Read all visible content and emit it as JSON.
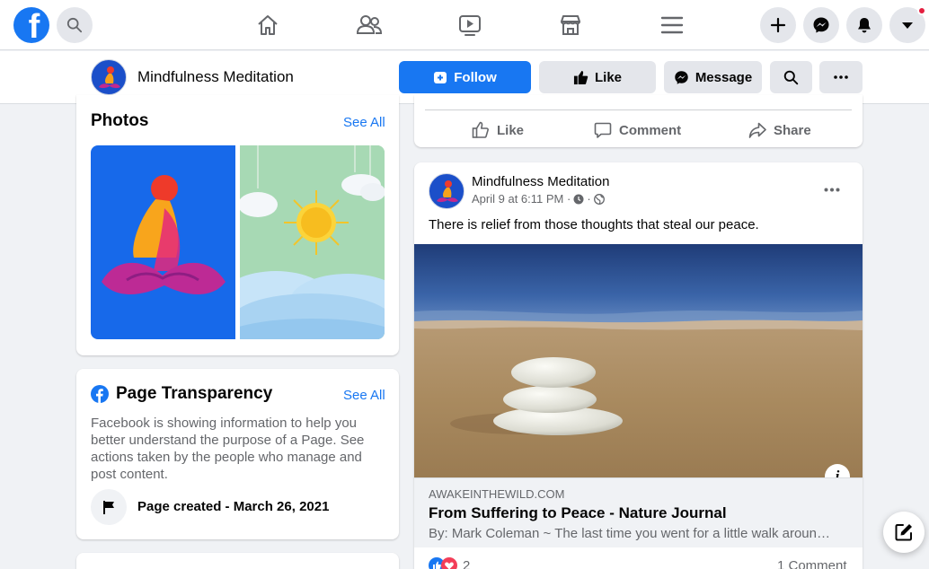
{
  "nav": {
    "logo_letter": "f",
    "icons": [
      "search-icon",
      "home-icon",
      "friends-icon",
      "watch-icon",
      "marketplace-icon",
      "menu-icon",
      "create-icon",
      "messenger-icon",
      "notifications-icon",
      "account-icon"
    ]
  },
  "page": {
    "name": "Mindfulness Meditation",
    "follow_label": "Follow",
    "like_label": "Like",
    "message_label": "Message"
  },
  "photos": {
    "title": "Photos",
    "see_all": "See All"
  },
  "transparency": {
    "title": "Page Transparency",
    "see_all": "See All",
    "description": "Facebook is showing information to help you better understand the purpose of a Page. See actions taken by the people who manage and post content.",
    "created": "Page created - March 26, 2021"
  },
  "post_actions": {
    "like": "Like",
    "comment": "Comment",
    "share": "Share"
  },
  "post": {
    "author": "Mindfulness Meditation",
    "time": "April 9 at 6:11 PM · ",
    "text": "There is relief from those thoughts that steal our peace.",
    "link_domain": "AWAKEINTHEWILD.COM",
    "link_title": "From Suffering to Peace - Nature Journal",
    "link_subtitle": "By: Mark Coleman ~ The last time you went for a little walk aroun…",
    "reaction_count": "2",
    "comment_count": "1 Comment"
  },
  "colors": {
    "brand": "#1877f2",
    "background": "#f0f2f5",
    "notification": "#e41e3f"
  }
}
